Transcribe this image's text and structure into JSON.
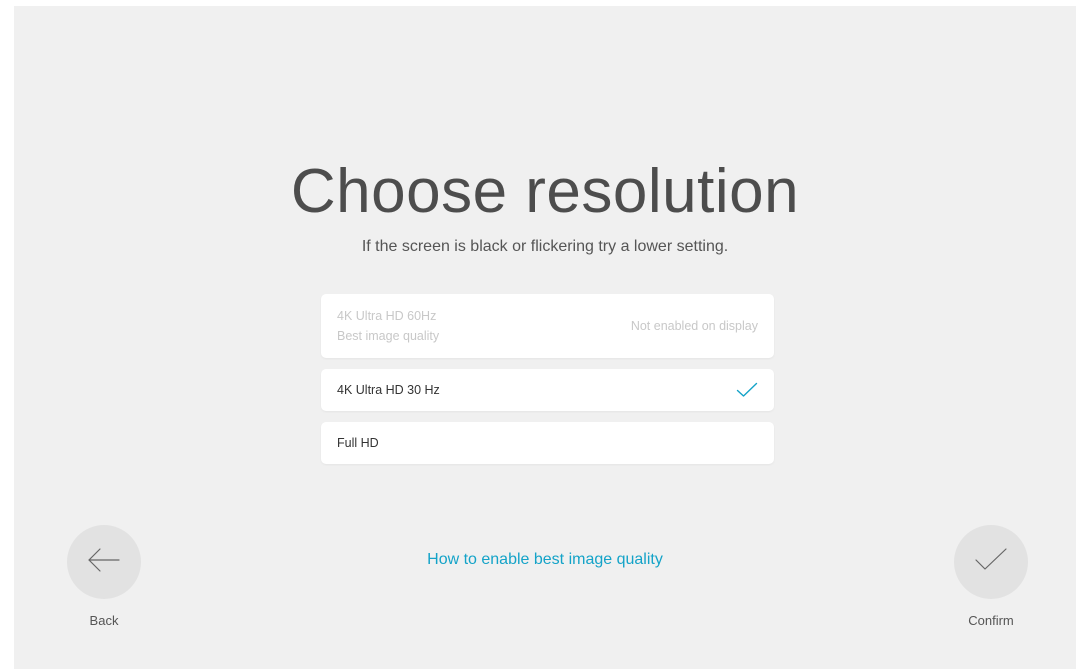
{
  "page": {
    "title": "Choose resolution",
    "subtitle": "If the screen is black or flickering try a lower setting."
  },
  "options": [
    {
      "label": "4K Ultra HD 60Hz",
      "sublabel": "Best image quality",
      "status": "Not enabled on display",
      "state": "disabled"
    },
    {
      "label": "4K Ultra HD 30 Hz",
      "state": "selected"
    },
    {
      "label": "Full HD",
      "state": "available"
    }
  ],
  "help_link": "How to enable best image quality",
  "back": {
    "label": "Back",
    "icon": "arrow-left-icon"
  },
  "confirm": {
    "label": "Confirm",
    "icon": "checkmark-icon"
  },
  "colors": {
    "background": "#f0f0f0",
    "accent": "#14a3c8",
    "button": "#e2e2e2",
    "disabled_text": "#c8c8c8"
  }
}
